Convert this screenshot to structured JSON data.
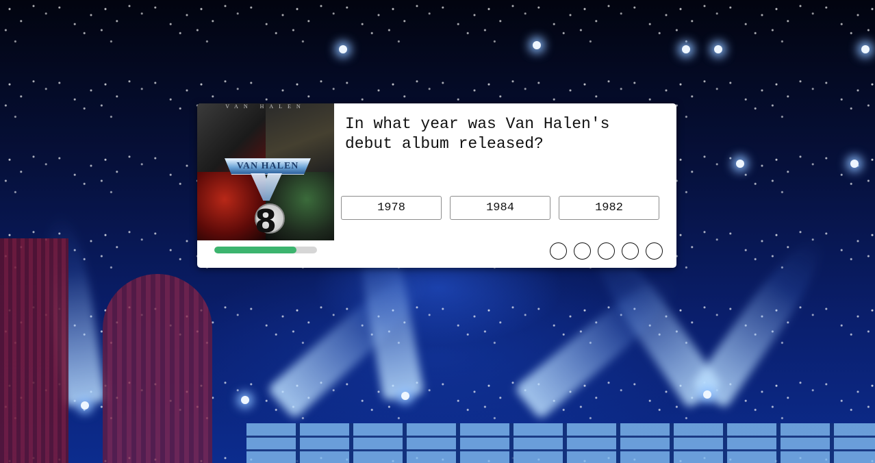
{
  "quiz": {
    "question": "In what year was Van Halen's debut album released?",
    "countdown": "8",
    "album_cover": {
      "band_text": "VAN HALEN",
      "logo_text": "VAN HALEN"
    },
    "answers": [
      {
        "label": "1978"
      },
      {
        "label": "1984"
      },
      {
        "label": "1982"
      }
    ],
    "timer_progress_percent": 80,
    "score_slots": [
      {
        "state": "empty"
      },
      {
        "state": "empty"
      },
      {
        "state": "empty"
      },
      {
        "state": "empty"
      },
      {
        "state": "empty"
      }
    ],
    "colors": {
      "progress_fill": "#3cb46e",
      "progress_track": "#d6d6d6",
      "card_background": "#ffffff"
    }
  }
}
